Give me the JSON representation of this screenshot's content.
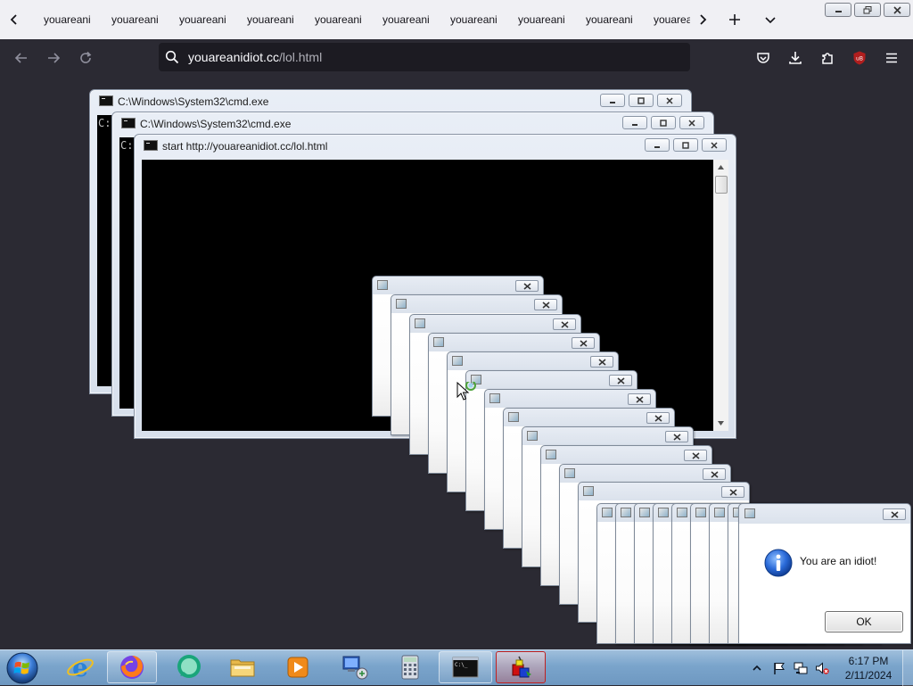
{
  "browser": {
    "tabs": [
      {
        "label": "youareani"
      },
      {
        "label": "youareani"
      },
      {
        "label": "youareani"
      },
      {
        "label": "youareani"
      },
      {
        "label": "youareani"
      },
      {
        "label": "youareani"
      },
      {
        "label": "youareani"
      },
      {
        "label": "youareani"
      },
      {
        "label": "youareani"
      },
      {
        "label": "youarea"
      }
    ],
    "url_domain": "youareanidiot.cc",
    "url_path": "/lol.html",
    "extension_badge": "uB"
  },
  "windows": {
    "cmd1_title": "C:\\Windows\\System32\\cmd.exe",
    "cmd2_title": "C:\\Windows\\System32\\cmd.exe",
    "cmd3_title": "start  http://youareanidiot.cc/lol.html",
    "console_prompt_1": "C:",
    "console_prompt_2": "C:"
  },
  "dialog": {
    "message": "You are an idiot!",
    "ok_label": "OK"
  },
  "taskbar": {
    "time": "6:17 PM",
    "date": "2/11/2024"
  },
  "colors": {
    "browser_chrome": "#f0f0f4",
    "browser_toolbar": "#2b2a33",
    "urlbar": "#1c1b22",
    "taskbar": "#7aa4cb",
    "info_blue": "#1f5fc9"
  }
}
